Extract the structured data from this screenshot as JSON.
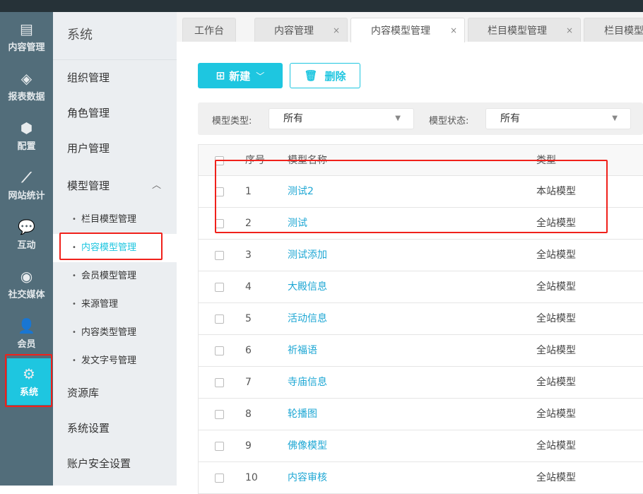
{
  "nav": [
    {
      "label": "内容管理",
      "icon": "document-icon"
    },
    {
      "label": "报表数据",
      "icon": "layers-icon"
    },
    {
      "label": "配置",
      "icon": "cube-icon"
    },
    {
      "label": "网站统计",
      "icon": "line-chart-icon"
    },
    {
      "label": "互动",
      "icon": "chat-icon"
    },
    {
      "label": "社交媒体",
      "icon": "target-icon"
    },
    {
      "label": "会员",
      "icon": "user-icon"
    },
    {
      "label": "系统",
      "icon": "gear-icon"
    }
  ],
  "sidebar": {
    "title": "系统",
    "items": [
      "组织管理",
      "角色管理",
      "用户管理"
    ],
    "group": "模型管理",
    "subs": [
      "栏目模型管理",
      "内容模型管理",
      "会员模型管理",
      "来源管理",
      "内容类型管理",
      "发文字号管理"
    ],
    "after": [
      "资源库",
      "系统设置",
      "账户安全设置"
    ]
  },
  "tabs": [
    "工作台",
    "内容管理",
    "内容模型管理",
    "栏目模型管理",
    "栏目模型"
  ],
  "toolbar": {
    "new": "新建",
    "delete": "删除"
  },
  "filter": {
    "type_label": "模型类型:",
    "type_value": "所有",
    "status_label": "模型状态:",
    "status_value": "所有"
  },
  "table": {
    "headers": [
      "序号",
      "模型名称",
      "类型"
    ],
    "rows": [
      [
        "1",
        "测试2",
        "本站模型"
      ],
      [
        "2",
        "测试",
        "全站模型"
      ],
      [
        "3",
        "测试添加",
        "全站模型"
      ],
      [
        "4",
        "大殿信息",
        "全站模型"
      ],
      [
        "5",
        "活动信息",
        "全站模型"
      ],
      [
        "6",
        "祈福语",
        "全站模型"
      ],
      [
        "7",
        "寺庙信息",
        "全站模型"
      ],
      [
        "8",
        "轮播图",
        "全站模型"
      ],
      [
        "9",
        "佛像模型",
        "全站模型"
      ],
      [
        "10",
        "内容审核",
        "全站模型"
      ]
    ]
  }
}
